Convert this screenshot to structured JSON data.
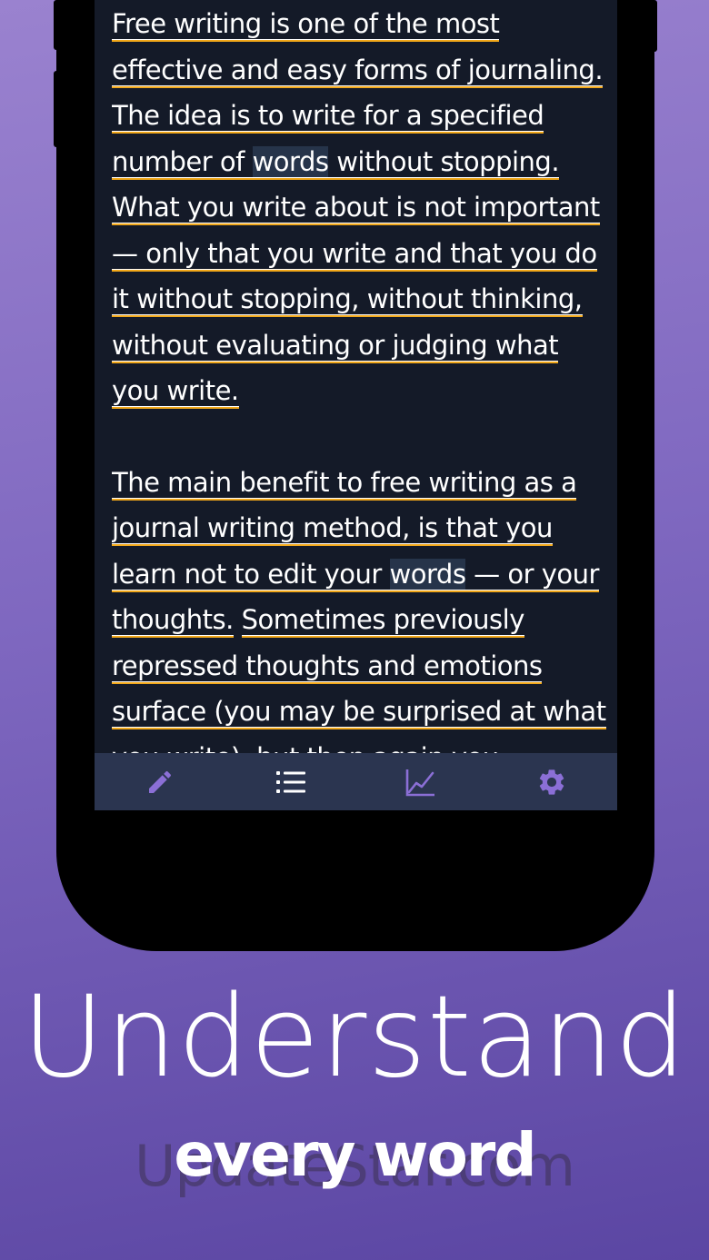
{
  "editor": {
    "paragraph1": {
      "s1": "Free writing is one of the most effective and easy forms of journaling.",
      "s2a": "The idea is to write for a specified number of ",
      "s2_word": "words",
      "s2b": " without stopping.",
      "s3": "What you write about is not important — only that you write and that you do it without stopping, without thinking, without evaluating or judging what you write."
    },
    "paragraph2": {
      "s1": "The main benefit to free writing as a journal writing method, is that you learn not to edit your ",
      "s1_word": "words",
      "s1b": " — or your thoughts.",
      "s2": "Sometimes previously repressed thoughts and emotions surface (you may be surprised at what you write), but then again you"
    },
    "highlight_color": "#f2a81a"
  },
  "tabbar": {
    "tabs": [
      {
        "icon": "pencil-icon",
        "color": "#8b6fd6"
      },
      {
        "icon": "list-icon",
        "color": "#ffffff"
      },
      {
        "icon": "chart-icon",
        "color": "#8b6fd6"
      },
      {
        "icon": "gear-icon",
        "color": "#8b6fd6"
      }
    ]
  },
  "promo": {
    "headline": "Understand",
    "subline": "every word",
    "watermark": "UpdateStar.com"
  },
  "colors": {
    "background_top": "#9a82cf",
    "background_bottom": "#5b46a3",
    "screen_bg": "#141a28",
    "tabbar_bg": "#2b3550",
    "accent": "#8b6fd6"
  }
}
